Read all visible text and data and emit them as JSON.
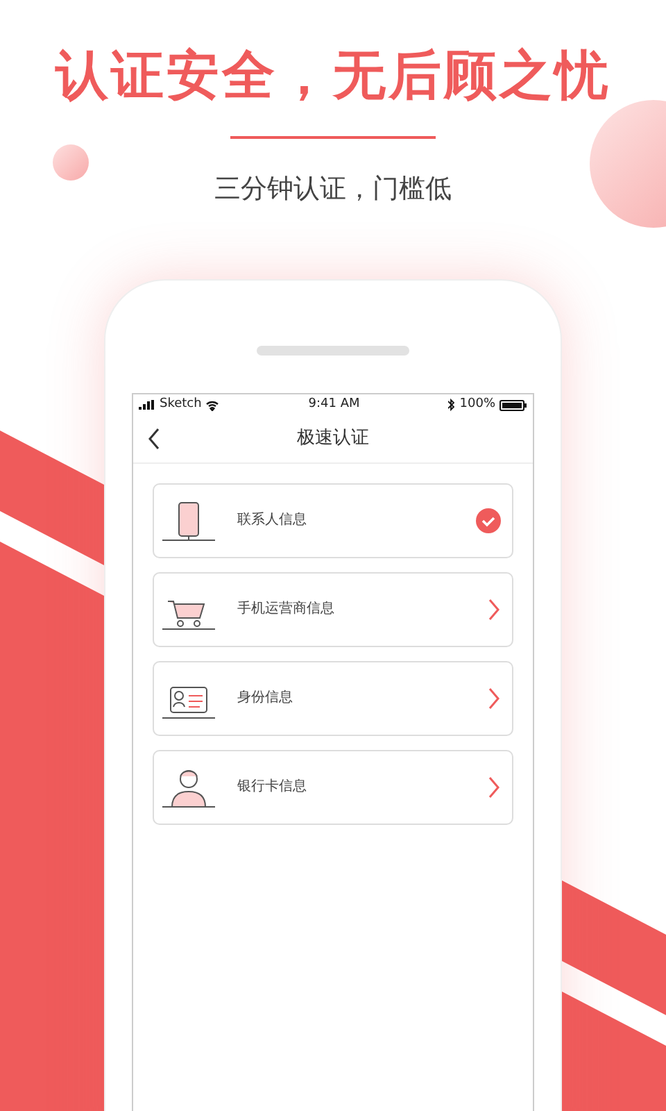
{
  "headline": "认证安全，无后顾之忧",
  "subtitle": "三分钟认证，门槛低",
  "status_bar": {
    "carrier": "Sketch",
    "time": "9:41 AM",
    "battery": "100%"
  },
  "nav": {
    "title": "极速认证"
  },
  "items": [
    {
      "kind": "phone",
      "label": "联系人信息",
      "completed": true
    },
    {
      "kind": "cart",
      "label": "手机运营商信息",
      "completed": false
    },
    {
      "kind": "id-card",
      "label": "身份信息",
      "completed": false
    },
    {
      "kind": "person",
      "label": "银行卡信息",
      "completed": false
    }
  ]
}
